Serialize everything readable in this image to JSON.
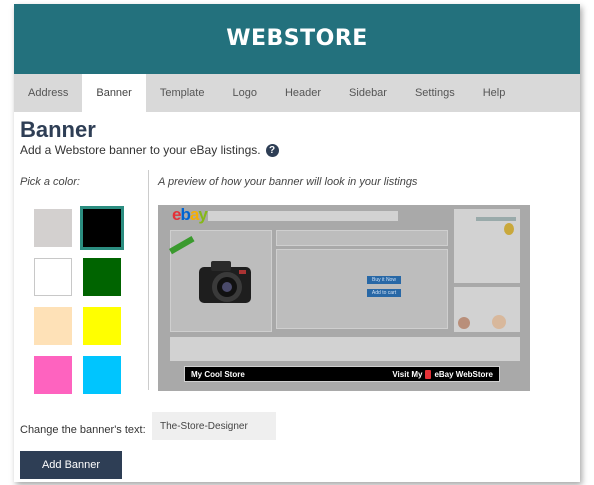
{
  "header": {
    "title": "WEBSTORE",
    "bg_color": "#23717d"
  },
  "tabs": [
    {
      "label": "Address"
    },
    {
      "label": "Banner",
      "active": true
    },
    {
      "label": "Template"
    },
    {
      "label": "Logo"
    },
    {
      "label": "Header"
    },
    {
      "label": "Sidebar"
    },
    {
      "label": "Settings"
    },
    {
      "label": "Help"
    }
  ],
  "page": {
    "title": "Banner",
    "subtitle": "Add a Webstore banner to your eBay listings.",
    "help_icon": "question-icon",
    "pick_label": "Pick a color:",
    "preview_label": "A preview of how your banner will look in your listings"
  },
  "colors": [
    {
      "name": "light-gray",
      "hex": "#d3d0cf",
      "selected": false
    },
    {
      "name": "black",
      "hex": "#000000",
      "selected": true
    },
    {
      "name": "white",
      "hex": "#ffffff",
      "selected": false
    },
    {
      "name": "dark-green",
      "hex": "#006400",
      "selected": false
    },
    {
      "name": "peach",
      "hex": "#fee1b7",
      "selected": false
    },
    {
      "name": "yellow",
      "hex": "#ffff00",
      "selected": false
    },
    {
      "name": "pink",
      "hex": "#fe63bf",
      "selected": false
    },
    {
      "name": "sky-blue",
      "hex": "#00c5fe",
      "selected": false
    }
  ],
  "preview": {
    "logo": {
      "e": "e",
      "b": "b",
      "a": "a",
      "y": "y"
    },
    "buy_now": "Buy it Now",
    "add_to_cart": "Add to cart",
    "banner_left": "My Cool Store",
    "banner_right": "Visit My",
    "banner_right2": "eBay WebStore"
  },
  "form": {
    "change_label": "Change the banner's text:",
    "banner_text": "The-Store-Designer",
    "add_button": "Add Banner"
  }
}
